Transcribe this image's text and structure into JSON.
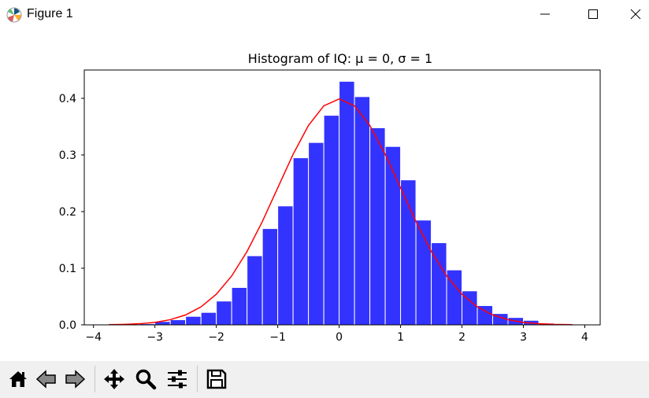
{
  "window": {
    "title": "Figure 1",
    "controls": {
      "minimize_icon": "minimize-icon",
      "maximize_icon": "maximize-icon",
      "close_icon": "close-icon"
    }
  },
  "toolbar": {
    "buttons": [
      {
        "name": "home-button",
        "icon": "home-icon"
      },
      {
        "name": "back-button",
        "icon": "arrow-left-icon"
      },
      {
        "name": "forward-button",
        "icon": "arrow-right-icon"
      },
      {
        "name": "pan-button",
        "icon": "move-icon"
      },
      {
        "name": "zoom-button",
        "icon": "magnifier-icon"
      },
      {
        "name": "configure-subplots-button",
        "icon": "sliders-icon"
      },
      {
        "name": "save-button",
        "icon": "floppy-disk-icon"
      }
    ]
  },
  "chart_data": {
    "type": "bar",
    "title": "Histogram of IQ: μ = 0, σ = 1",
    "xlabel": "",
    "ylabel": "",
    "xlim": [
      -4.15,
      4.25
    ],
    "ylim": [
      0,
      0.45
    ],
    "xticks": [
      -4,
      -3,
      -2,
      -1,
      0,
      1,
      2,
      3,
      4
    ],
    "xtick_labels": [
      "−4",
      "−3",
      "−2",
      "−1",
      "0",
      "1",
      "2",
      "3",
      "4"
    ],
    "yticks": [
      0.0,
      0.1,
      0.2,
      0.3,
      0.4
    ],
    "ytick_labels": [
      "0.0",
      "0.1",
      "0.2",
      "0.3",
      "0.4"
    ],
    "grid": false,
    "bar_color": "#3333ff",
    "bar_edge_color": "#ffffff",
    "curve_color": "#ff0000",
    "bins": {
      "edges": [
        -3.75,
        -3.5,
        -3.25,
        -3.0,
        -2.75,
        -2.5,
        -2.25,
        -2.0,
        -1.75,
        -1.5,
        -1.25,
        -1.0,
        -0.75,
        -0.5,
        -0.25,
        0.0,
        0.25,
        0.5,
        0.75,
        1.0,
        1.25,
        1.5,
        1.75,
        2.0,
        2.25,
        2.5,
        2.75,
        3.0,
        3.25,
        3.5,
        3.75
      ],
      "values": [
        0.0,
        0.001,
        0.002,
        0.006,
        0.009,
        0.015,
        0.022,
        0.042,
        0.066,
        0.122,
        0.17,
        0.21,
        0.295,
        0.322,
        0.37,
        0.43,
        0.403,
        0.348,
        0.315,
        0.256,
        0.185,
        0.145,
        0.097,
        0.06,
        0.034,
        0.02,
        0.013,
        0.008,
        0.003,
        0.001
      ]
    },
    "series": [
      {
        "type": "line",
        "x": [
          -3.75,
          -3.5,
          -3.25,
          -3.0,
          -2.75,
          -2.5,
          -2.25,
          -2.0,
          -1.75,
          -1.5,
          -1.25,
          -1.0,
          -0.75,
          -0.5,
          -0.25,
          0.0,
          0.25,
          0.5,
          0.75,
          1.0,
          1.25,
          1.5,
          1.75,
          2.0,
          2.25,
          2.5,
          2.75,
          3.0,
          3.25,
          3.5,
          3.8
        ],
        "y": [
          0.0004,
          0.0009,
          0.002,
          0.0044,
          0.0091,
          0.0175,
          0.0317,
          0.054,
          0.0863,
          0.1295,
          0.1826,
          0.242,
          0.3011,
          0.3521,
          0.3867,
          0.3989,
          0.3867,
          0.3521,
          0.3011,
          0.242,
          0.1826,
          0.1295,
          0.0863,
          0.054,
          0.0317,
          0.0175,
          0.0091,
          0.0044,
          0.002,
          0.0009,
          0.0003
        ]
      }
    ]
  }
}
